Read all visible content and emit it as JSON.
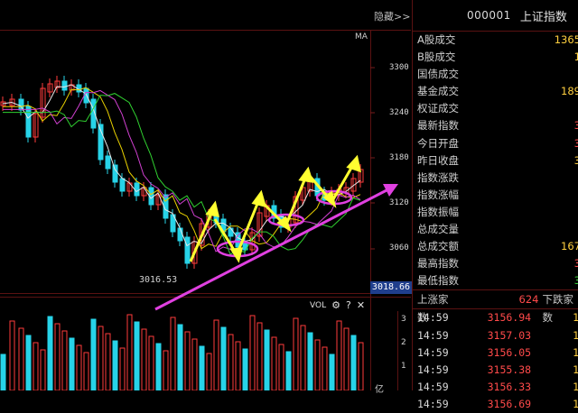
{
  "header": {
    "hide_label": "隐藏>>",
    "code": "000001",
    "name": "上证指数"
  },
  "main_chart": {
    "ma_label": "MA",
    "y_ticks": [
      "3300",
      "3240",
      "3180",
      "3120",
      "3060"
    ],
    "current_price": "3018.66",
    "low_label": "3016.53"
  },
  "volume_panel": {
    "label": "VOL",
    "y_ticks": [
      "3",
      "2",
      "1"
    ],
    "unit": "亿"
  },
  "info_rows": [
    {
      "label": "A股成交",
      "value": "1365",
      "color": "yellow"
    },
    {
      "label": "B股成交",
      "value": "1",
      "color": "yellow"
    },
    {
      "label": "国债成交",
      "value": "",
      "color": "yellow"
    },
    {
      "label": "基金成交",
      "value": "189",
      "color": "yellow"
    },
    {
      "label": "权证成交",
      "value": "",
      "color": "yellow"
    },
    {
      "label": "最新指数",
      "value": "3",
      "color": "red"
    },
    {
      "label": "今日开盘",
      "value": "3",
      "color": "red"
    },
    {
      "label": "昨日收盘",
      "value": "3",
      "color": "yellow"
    },
    {
      "label": "指数涨跌",
      "value": "",
      "color": "red"
    },
    {
      "label": "指数涨幅",
      "value": "",
      "color": "red"
    },
    {
      "label": "指数振幅",
      "value": "",
      "color": "red"
    },
    {
      "label": "总成交量",
      "value": "",
      "color": "yellow"
    },
    {
      "label": "总成交额",
      "value": "167",
      "color": "yellow"
    },
    {
      "label": "最高指数",
      "value": "3",
      "color": "red"
    },
    {
      "label": "最低指数",
      "value": "3",
      "color": "green"
    }
  ],
  "advance_decline": {
    "up_label": "上涨家数",
    "up_value": "624",
    "down_label": "下跌家数"
  },
  "ticks": [
    {
      "time": "14:59",
      "price": "3156.94",
      "vol": "1"
    },
    {
      "time": "14:59",
      "price": "3157.03",
      "vol": "1"
    },
    {
      "time": "14:59",
      "price": "3156.05",
      "vol": "1"
    },
    {
      "time": "14:59",
      "price": "3155.38",
      "vol": "1"
    },
    {
      "time": "14:59",
      "price": "3156.33",
      "vol": "1"
    },
    {
      "time": "14:59",
      "price": "3156.69",
      "vol": "1"
    }
  ]
}
